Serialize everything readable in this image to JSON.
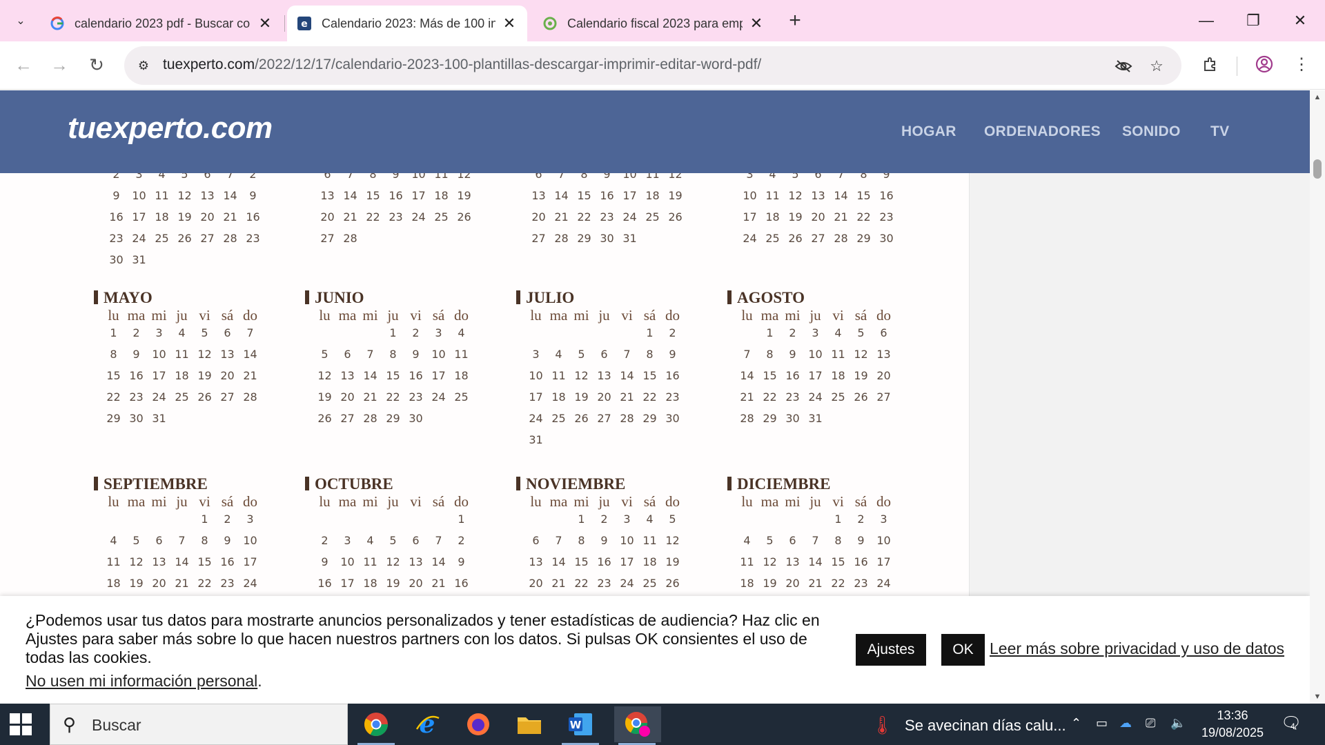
{
  "browser": {
    "tabs": [
      {
        "title": "calendario 2023 pdf - Buscar co",
        "favicon": "google-icon"
      },
      {
        "title": "Calendario 2023: Más de 100 in",
        "favicon": "tuexperto-icon"
      },
      {
        "title": "Calendario fiscal 2023 para emp",
        "favicon": "green-icon"
      }
    ],
    "url_domain": "tuexperto.com",
    "url_path": "/2022/12/17/calendario-2023-100-plantillas-descargar-imprimir-editar-word-pdf/"
  },
  "site": {
    "logo": "tuexperto.com",
    "nav": [
      "HOGAR",
      "ORDENADORES",
      "SONIDO",
      "TV"
    ]
  },
  "calendar": {
    "weekdays": [
      "lu",
      "ma",
      "mi",
      "ju",
      "vi",
      "sá",
      "do"
    ],
    "top_row": [
      {
        "rows": [
          [
            "2",
            "3",
            "4",
            "5",
            "6",
            "7",
            "2"
          ],
          [
            "9",
            "10",
            "11",
            "12",
            "13",
            "14",
            "9"
          ],
          [
            "16",
            "17",
            "18",
            "19",
            "20",
            "21",
            "16"
          ],
          [
            "23",
            "24",
            "25",
            "26",
            "27",
            "28",
            "23"
          ],
          [
            "30",
            "31",
            "",
            "",
            "",
            "",
            ""
          ]
        ]
      },
      {
        "rows": [
          [
            "6",
            "7",
            "8",
            "9",
            "10",
            "11",
            "12"
          ],
          [
            "13",
            "14",
            "15",
            "16",
            "17",
            "18",
            "19"
          ],
          [
            "20",
            "21",
            "22",
            "23",
            "24",
            "25",
            "26"
          ],
          [
            "27",
            "28",
            "",
            "",
            "",
            "",
            ""
          ],
          [
            "",
            "",
            "",
            "",
            "",
            "",
            ""
          ]
        ]
      },
      {
        "rows": [
          [
            "6",
            "7",
            "8",
            "9",
            "10",
            "11",
            "12"
          ],
          [
            "13",
            "14",
            "15",
            "16",
            "17",
            "18",
            "19"
          ],
          [
            "20",
            "21",
            "22",
            "23",
            "24",
            "25",
            "26"
          ],
          [
            "27",
            "28",
            "29",
            "30",
            "31",
            "",
            ""
          ],
          [
            "",
            "",
            "",
            "",
            "",
            "",
            ""
          ]
        ]
      },
      {
        "rows": [
          [
            "3",
            "4",
            "5",
            "6",
            "7",
            "8",
            "9"
          ],
          [
            "10",
            "11",
            "12",
            "13",
            "14",
            "15",
            "16"
          ],
          [
            "17",
            "18",
            "19",
            "20",
            "21",
            "22",
            "23"
          ],
          [
            "24",
            "25",
            "26",
            "27",
            "28",
            "29",
            "30"
          ],
          [
            "",
            "",
            "",
            "",
            "",
            "",
            ""
          ]
        ]
      }
    ],
    "months": [
      {
        "name": "MAYO",
        "rows": [
          [
            "1",
            "2",
            "3",
            "4",
            "5",
            "6",
            "7"
          ],
          [
            "8",
            "9",
            "10",
            "11",
            "12",
            "13",
            "14"
          ],
          [
            "15",
            "16",
            "17",
            "18",
            "19",
            "20",
            "21"
          ],
          [
            "22",
            "23",
            "24",
            "25",
            "26",
            "27",
            "28"
          ],
          [
            "29",
            "30",
            "31",
            "",
            "",
            "",
            ""
          ],
          [
            "",
            "",
            "",
            "",
            "",
            "",
            ""
          ]
        ]
      },
      {
        "name": "JUNIO",
        "rows": [
          [
            "",
            "",
            "",
            "1",
            "2",
            "3",
            "4"
          ],
          [
            "5",
            "6",
            "7",
            "8",
            "9",
            "10",
            "11"
          ],
          [
            "12",
            "13",
            "14",
            "15",
            "16",
            "17",
            "18"
          ],
          [
            "19",
            "20",
            "21",
            "22",
            "23",
            "24",
            "25"
          ],
          [
            "26",
            "27",
            "28",
            "29",
            "30",
            "",
            ""
          ],
          [
            "",
            "",
            "",
            "",
            "",
            "",
            ""
          ]
        ]
      },
      {
        "name": "JULIO",
        "rows": [
          [
            "",
            "",
            "",
            "",
            "",
            "1",
            "2"
          ],
          [
            "3",
            "4",
            "5",
            "6",
            "7",
            "8",
            "9"
          ],
          [
            "10",
            "11",
            "12",
            "13",
            "14",
            "15",
            "16"
          ],
          [
            "17",
            "18",
            "19",
            "20",
            "21",
            "22",
            "23"
          ],
          [
            "24",
            "25",
            "26",
            "27",
            "28",
            "29",
            "30"
          ],
          [
            "31",
            "",
            "",
            "",
            "",
            "",
            ""
          ]
        ]
      },
      {
        "name": "AGOSTO",
        "rows": [
          [
            "",
            "1",
            "2",
            "3",
            "4",
            "5",
            "6"
          ],
          [
            "7",
            "8",
            "9",
            "10",
            "11",
            "12",
            "13"
          ],
          [
            "14",
            "15",
            "16",
            "17",
            "18",
            "19",
            "20"
          ],
          [
            "21",
            "22",
            "23",
            "24",
            "25",
            "26",
            "27"
          ],
          [
            "28",
            "29",
            "30",
            "31",
            "",
            "",
            ""
          ],
          [
            "",
            "",
            "",
            "",
            "",
            "",
            ""
          ]
        ]
      },
      {
        "name": "SEPTIEMBRE",
        "rows": [
          [
            "",
            "",
            "",
            "",
            "1",
            "2",
            "3"
          ],
          [
            "4",
            "5",
            "6",
            "7",
            "8",
            "9",
            "10"
          ],
          [
            "11",
            "12",
            "13",
            "14",
            "15",
            "16",
            "17"
          ],
          [
            "18",
            "19",
            "20",
            "21",
            "22",
            "23",
            "24"
          ]
        ]
      },
      {
        "name": "OCTUBRE",
        "rows": [
          [
            "",
            "",
            "",
            "",
            "",
            "",
            "1"
          ],
          [
            "2",
            "3",
            "4",
            "5",
            "6",
            "7",
            "2"
          ],
          [
            "9",
            "10",
            "11",
            "12",
            "13",
            "14",
            "9"
          ],
          [
            "16",
            "17",
            "18",
            "19",
            "20",
            "21",
            "16"
          ]
        ]
      },
      {
        "name": "NOVIEMBRE",
        "rows": [
          [
            "",
            "",
            "1",
            "2",
            "3",
            "4",
            "5"
          ],
          [
            "6",
            "7",
            "8",
            "9",
            "10",
            "11",
            "12"
          ],
          [
            "13",
            "14",
            "15",
            "16",
            "17",
            "18",
            "19"
          ],
          [
            "20",
            "21",
            "22",
            "23",
            "24",
            "25",
            "26"
          ]
        ]
      },
      {
        "name": "DICIEMBRE",
        "rows": [
          [
            "",
            "",
            "",
            "",
            "1",
            "2",
            "3"
          ],
          [
            "4",
            "5",
            "6",
            "7",
            "8",
            "9",
            "10"
          ],
          [
            "11",
            "12",
            "13",
            "14",
            "15",
            "16",
            "17"
          ],
          [
            "18",
            "19",
            "20",
            "21",
            "22",
            "23",
            "24"
          ]
        ]
      }
    ]
  },
  "cookie": {
    "message": "¿Podemos usar tus datos para mostrarte anuncios personalizados y tener estadísticas de audiencia? Haz clic en Ajustes para saber más sobre lo que hacen nuestros partners con los datos. Si pulsas OK consientes el uso de todas las cookies.",
    "optout": "No usen mi información personal",
    "optout_suffix": ".",
    "settings": "Ajustes",
    "ok": "OK",
    "privacy": "Leer más sobre privacidad y uso de datos"
  },
  "taskbar": {
    "search": "Buscar",
    "weather": "Se avecinan días calu...",
    "time": "13:36",
    "date": "19/08/2025",
    "notifications": "4"
  }
}
